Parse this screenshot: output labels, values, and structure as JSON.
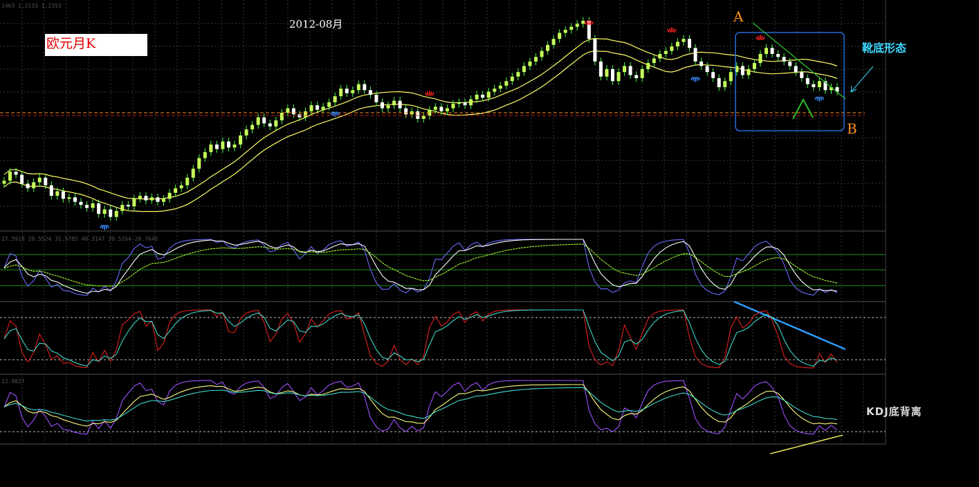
{
  "window": {
    "price_readout": "1463 1.2133 1.2353",
    "osc1_readout": "27.5918 29.5524 31.5785 40.3147 39.5164 28.7645",
    "osc3_readout": "12.9827"
  },
  "annotations": {
    "title": "欧元月K",
    "date": "2012-08月",
    "pattern": "靴底形态",
    "divergence": "KDJ底背离",
    "point_a": "A",
    "point_b": "B"
  },
  "colors": {
    "bull_candle": "#c8ff5a",
    "bear_candle": "#ffffff",
    "wick": "#4cff4c",
    "ma_band": "#ffff66",
    "grid": "#3a3a3a",
    "highlight_box": "#2a7fff",
    "downtrend": "#2ebd2e",
    "fractal_top": "#ff2020",
    "fractal_bottom": "#3d8bff",
    "osc_fast": "#6b6bff",
    "osc_slow": "#ffffff",
    "osc_signal": "#aaff33",
    "stoch_k": "#e02020",
    "stoch_d": "#3fd9c9",
    "kdj_k": "#a050ff",
    "kdj_d": "#ffff80",
    "kdj_j": "#3fd9c9",
    "divergence_line_top": "#2a9dff",
    "divergence_line_bottom": "#ffff66"
  },
  "chart_data": {
    "type": "line",
    "series": [
      {
        "values": [
          0.36,
          0.42,
          0.4,
          0.34,
          0.31,
          0.35,
          0.38,
          0.33,
          0.26,
          0.29,
          0.24,
          0.25,
          0.22,
          0.2,
          0.18,
          0.21,
          0.14,
          0.17,
          0.12,
          0.16,
          0.2,
          0.19,
          0.24,
          0.26,
          0.23,
          0.25,
          0.22,
          0.24,
          0.28,
          0.31,
          0.33,
          0.38,
          0.44,
          0.51,
          0.55,
          0.6,
          0.57,
          0.62,
          0.58,
          0.6,
          0.66,
          0.7,
          0.73,
          0.78,
          0.74,
          0.72,
          0.76,
          0.81,
          0.84,
          0.8,
          0.78,
          0.82,
          0.86,
          0.83,
          0.85,
          0.88,
          0.92,
          0.97,
          0.94,
          0.96,
          1.0,
          0.96,
          0.93,
          0.88,
          0.84,
          0.86,
          0.89,
          0.84,
          0.8,
          0.82,
          0.77,
          0.79,
          0.83,
          0.85,
          0.82,
          0.84,
          0.87,
          0.88,
          0.86,
          0.9,
          0.93,
          0.91,
          0.95,
          0.97,
          0.99,
          1.02,
          1.05,
          1.08,
          1.12,
          1.15,
          1.18,
          1.22,
          1.26,
          1.3,
          1.34,
          1.36,
          1.38,
          1.4,
          1.42,
          1.3,
          1.15,
          1.05,
          1.1,
          1.02,
          1.08,
          1.12,
          1.06,
          1.04,
          1.1,
          1.14,
          1.17,
          1.2,
          1.22,
          1.25,
          1.28,
          1.3,
          1.24,
          1.15,
          1.12,
          1.08,
          1.04,
          0.98,
          1.02,
          1.08,
          1.12,
          1.06,
          1.1,
          1.14,
          1.2,
          1.24,
          1.2,
          1.18,
          1.15,
          1.12,
          1.08,
          1.04,
          1.0,
          0.98,
          1.02,
          0.96,
          0.98,
          0.95
        ]
      }
    ]
  }
}
